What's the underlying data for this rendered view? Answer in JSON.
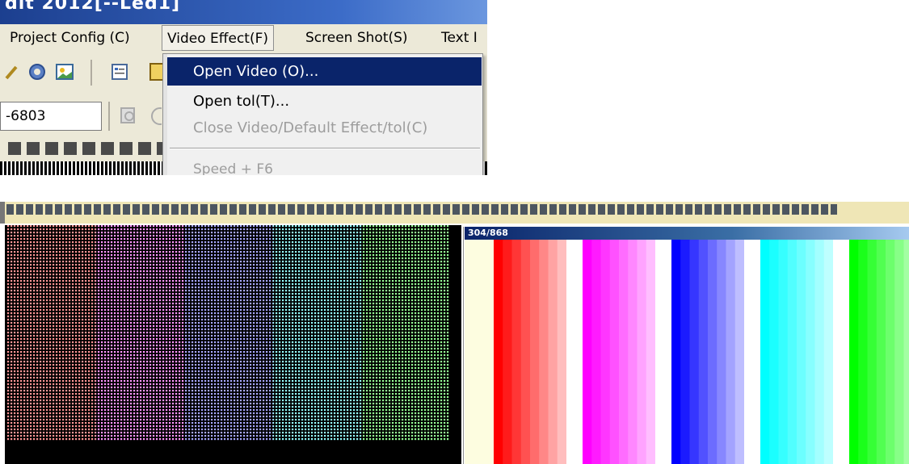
{
  "window": {
    "title": "dit 2012[--Led1]"
  },
  "menubar": {
    "items": [
      "Project Config (C)",
      "Video Effect(F)",
      "Screen Shot(S)",
      "Text I"
    ],
    "active": "Video Effect(F)"
  },
  "toolbar": {
    "combo_value": "-6803"
  },
  "dropdown": {
    "items": [
      {
        "label": "Open Video (O)...",
        "state": "highlighted"
      },
      {
        "label": "Open tol(T)...",
        "state": "enabled"
      },
      {
        "label": "Close Video/Default Effect/tol(C)",
        "state": "disabled"
      },
      {
        "label": "Speed +  F6",
        "state": "disabled"
      }
    ]
  },
  "preview": {
    "counter": "304/868",
    "led_colors": [
      "#ff4040",
      "#ff40ff",
      "#6060ff",
      "#40ffff",
      "#40ff40"
    ],
    "bar_groups": [
      {
        "name": "red",
        "color": "#ff0000"
      },
      {
        "name": "magenta",
        "color": "#ff00ff"
      },
      {
        "name": "blue",
        "color": "#0000ff"
      },
      {
        "name": "cyan",
        "color": "#00ffff"
      },
      {
        "name": "green",
        "color": "#00ff00"
      }
    ]
  },
  "colors": {
    "menu_highlight": "#0a246a",
    "ledbar_bg": "#efe6b6"
  }
}
